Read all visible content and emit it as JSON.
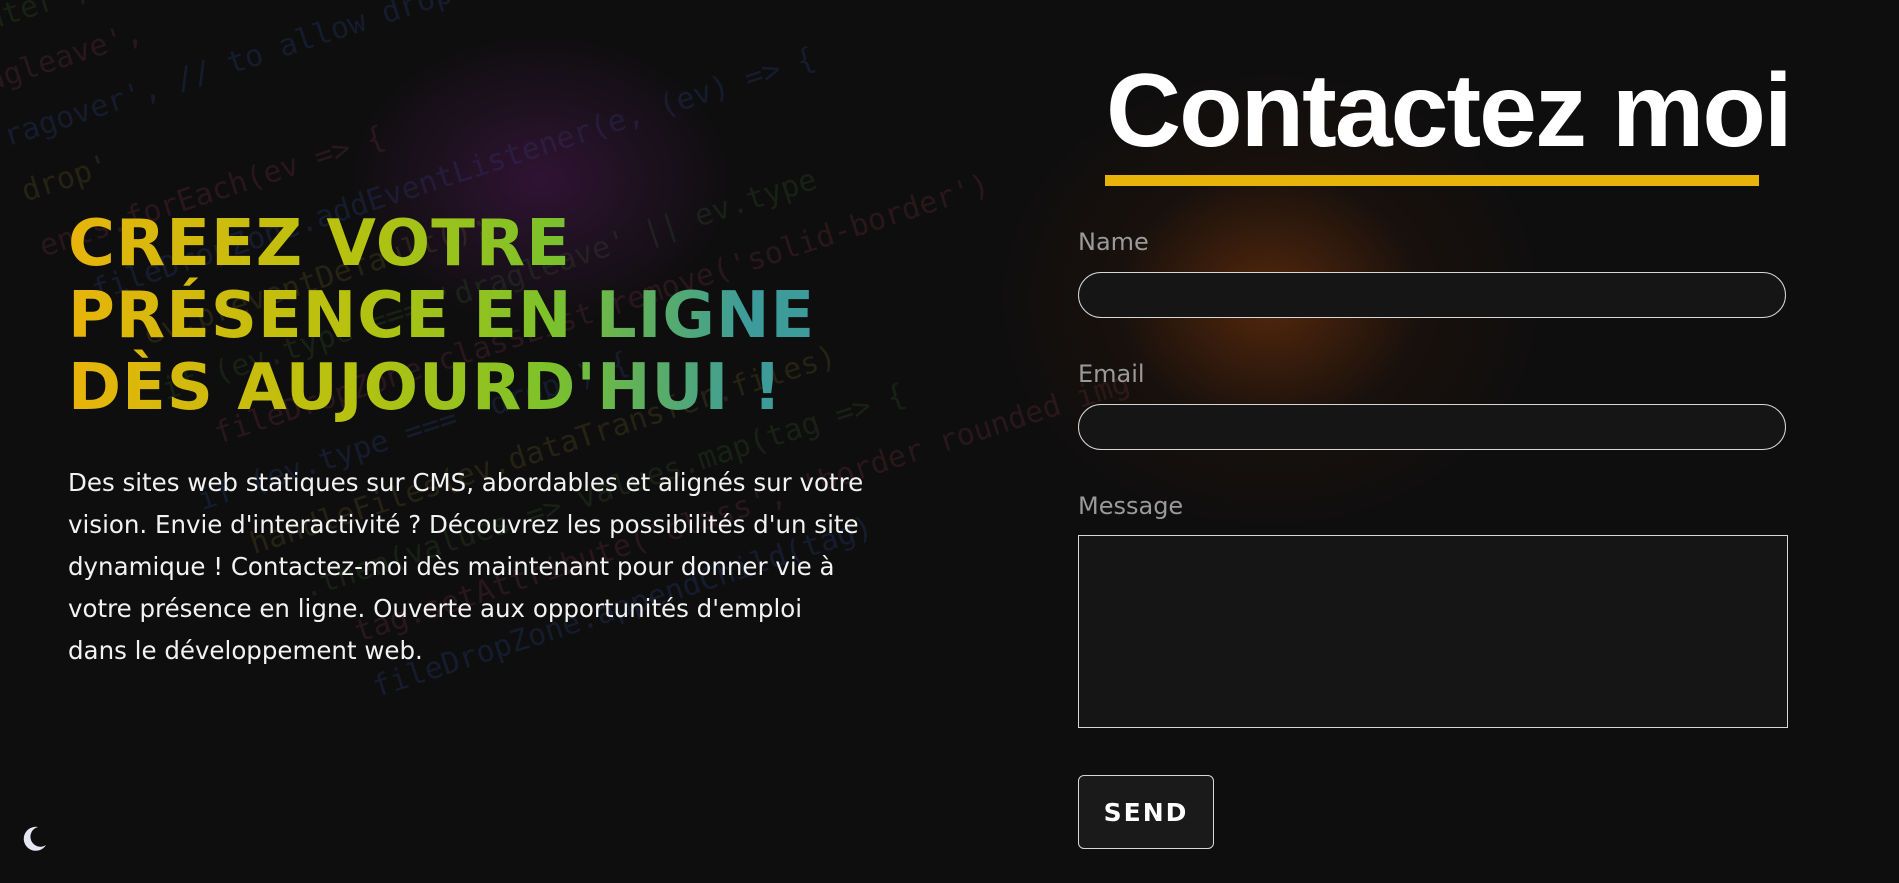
{
  "hero": {
    "title_lines": [
      "CREEZ VOTRE",
      "PRÉSENCE EN LIGNE",
      "DÈS AUJOURD'HUI !"
    ],
    "description": "Des sites web statiques sur CMS, abordables et alignés sur votre vision. Envie d'interactivité ? Découvrez les possibilités d'un site dynamique ! Contactez-moi dès maintenant pour donner vie à votre présence en ligne. Ouverte aux opportunités d'emploi dans le développement web."
  },
  "contact": {
    "title": "Contactez moi",
    "name_label": "Name",
    "name_value": "",
    "email_label": "Email",
    "email_value": "",
    "message_label": "Message",
    "message_value": "",
    "send_label": "SEND"
  },
  "background_code": [
    "enter',",
    "agleave',",
    "ragover', // to allow drop",
    "drop'",
    "",
    "ents.forEach(ev => {",
    "  fileDropZone.addEventListener(e, (ev) => {",
    "    ev.preventDefault();",
    "    if (ev.type === 'dragleave' || ev.type",
    "      fileDropZone.classList.remove('solid-border')",
    "    if (ev.type === 'drop') {",
    "      handleFiles(ev.dataTransfer.files)",
    "        .then(values => values.map(tag => {",
    "          tag.setAttribute('class', 'border rounded img'",
    "          fileDropZone.appendChild(tag)"
  ],
  "theme_toggle_icon": "moon-icon",
  "colors": {
    "accent": "#e8b40a",
    "background": "#0e0e0e",
    "gradient": [
      "#e8b40a",
      "#b7c20f",
      "#7dc22a",
      "#3d9c9a"
    ]
  }
}
